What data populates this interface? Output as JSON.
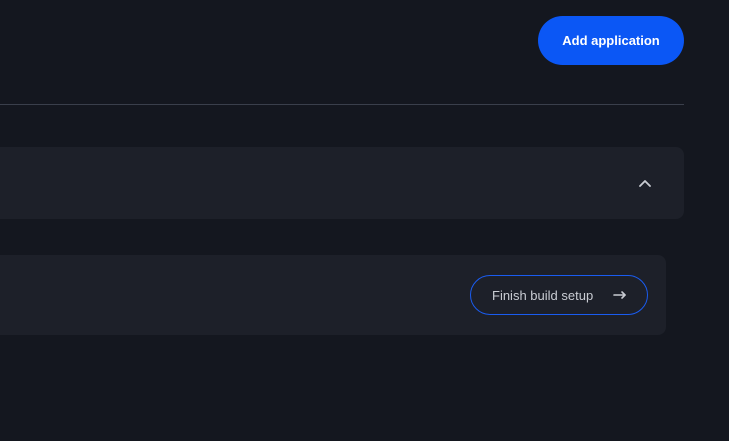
{
  "header": {
    "add_application_label": "Add application"
  },
  "applications_section": {
    "collapse_icon": "chevron-up-icon"
  },
  "setup_card": {
    "finish_build_setup_label": "Finish build setup",
    "arrow_icon": "arrow-right-icon"
  },
  "colors": {
    "background": "#14171f",
    "panel": "#1d2029",
    "accent": "#0b57f5"
  }
}
